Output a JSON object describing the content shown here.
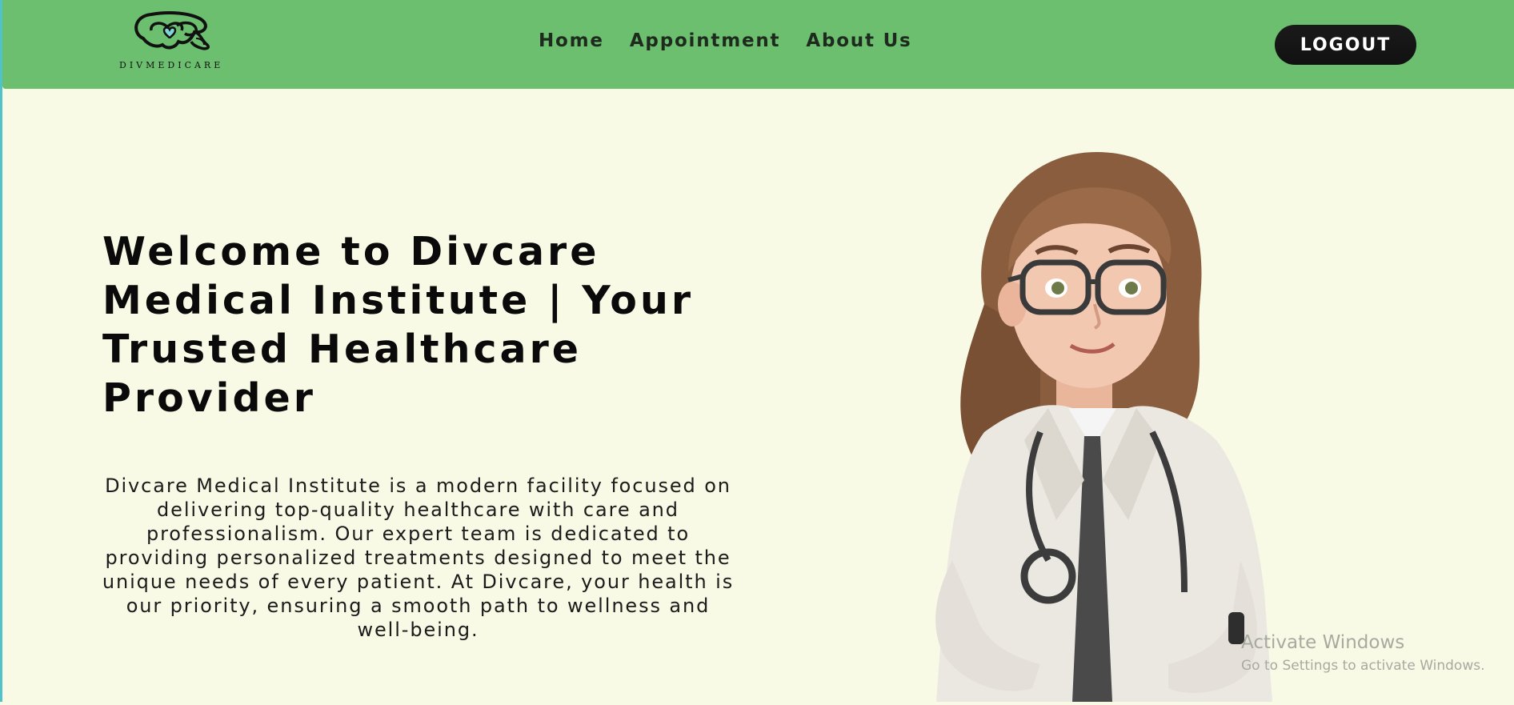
{
  "header": {
    "logo_text": "DIVMEDICARE",
    "nav": {
      "home": "Home",
      "appointment": "Appointment",
      "about": "About Us"
    },
    "logout_label": "LOGOUT"
  },
  "hero": {
    "title": "Welcome to Divcare Medical Institute | Your Trusted Healthcare Provider",
    "description": "Divcare Medical Institute is a modern facility focused on delivering top-quality healthcare with care and professionalism. Our expert team is dedicated to providing personalized treatments designed to meet the unique needs of every patient. At Divcare, your health is our priority, ensuring a smooth path to wellness and well-being."
  },
  "watermark": {
    "line1": "Activate Windows",
    "line2": "Go to Settings to activate Windows."
  },
  "colors": {
    "header_bg": "#6cbf6e",
    "page_bg": "#f8fae6",
    "button_bg": "#111111",
    "accent_cyan": "#4fc3c9"
  },
  "icons": {
    "logo": "brain-heart-logo-icon",
    "illustration": "doctor-illustration"
  }
}
